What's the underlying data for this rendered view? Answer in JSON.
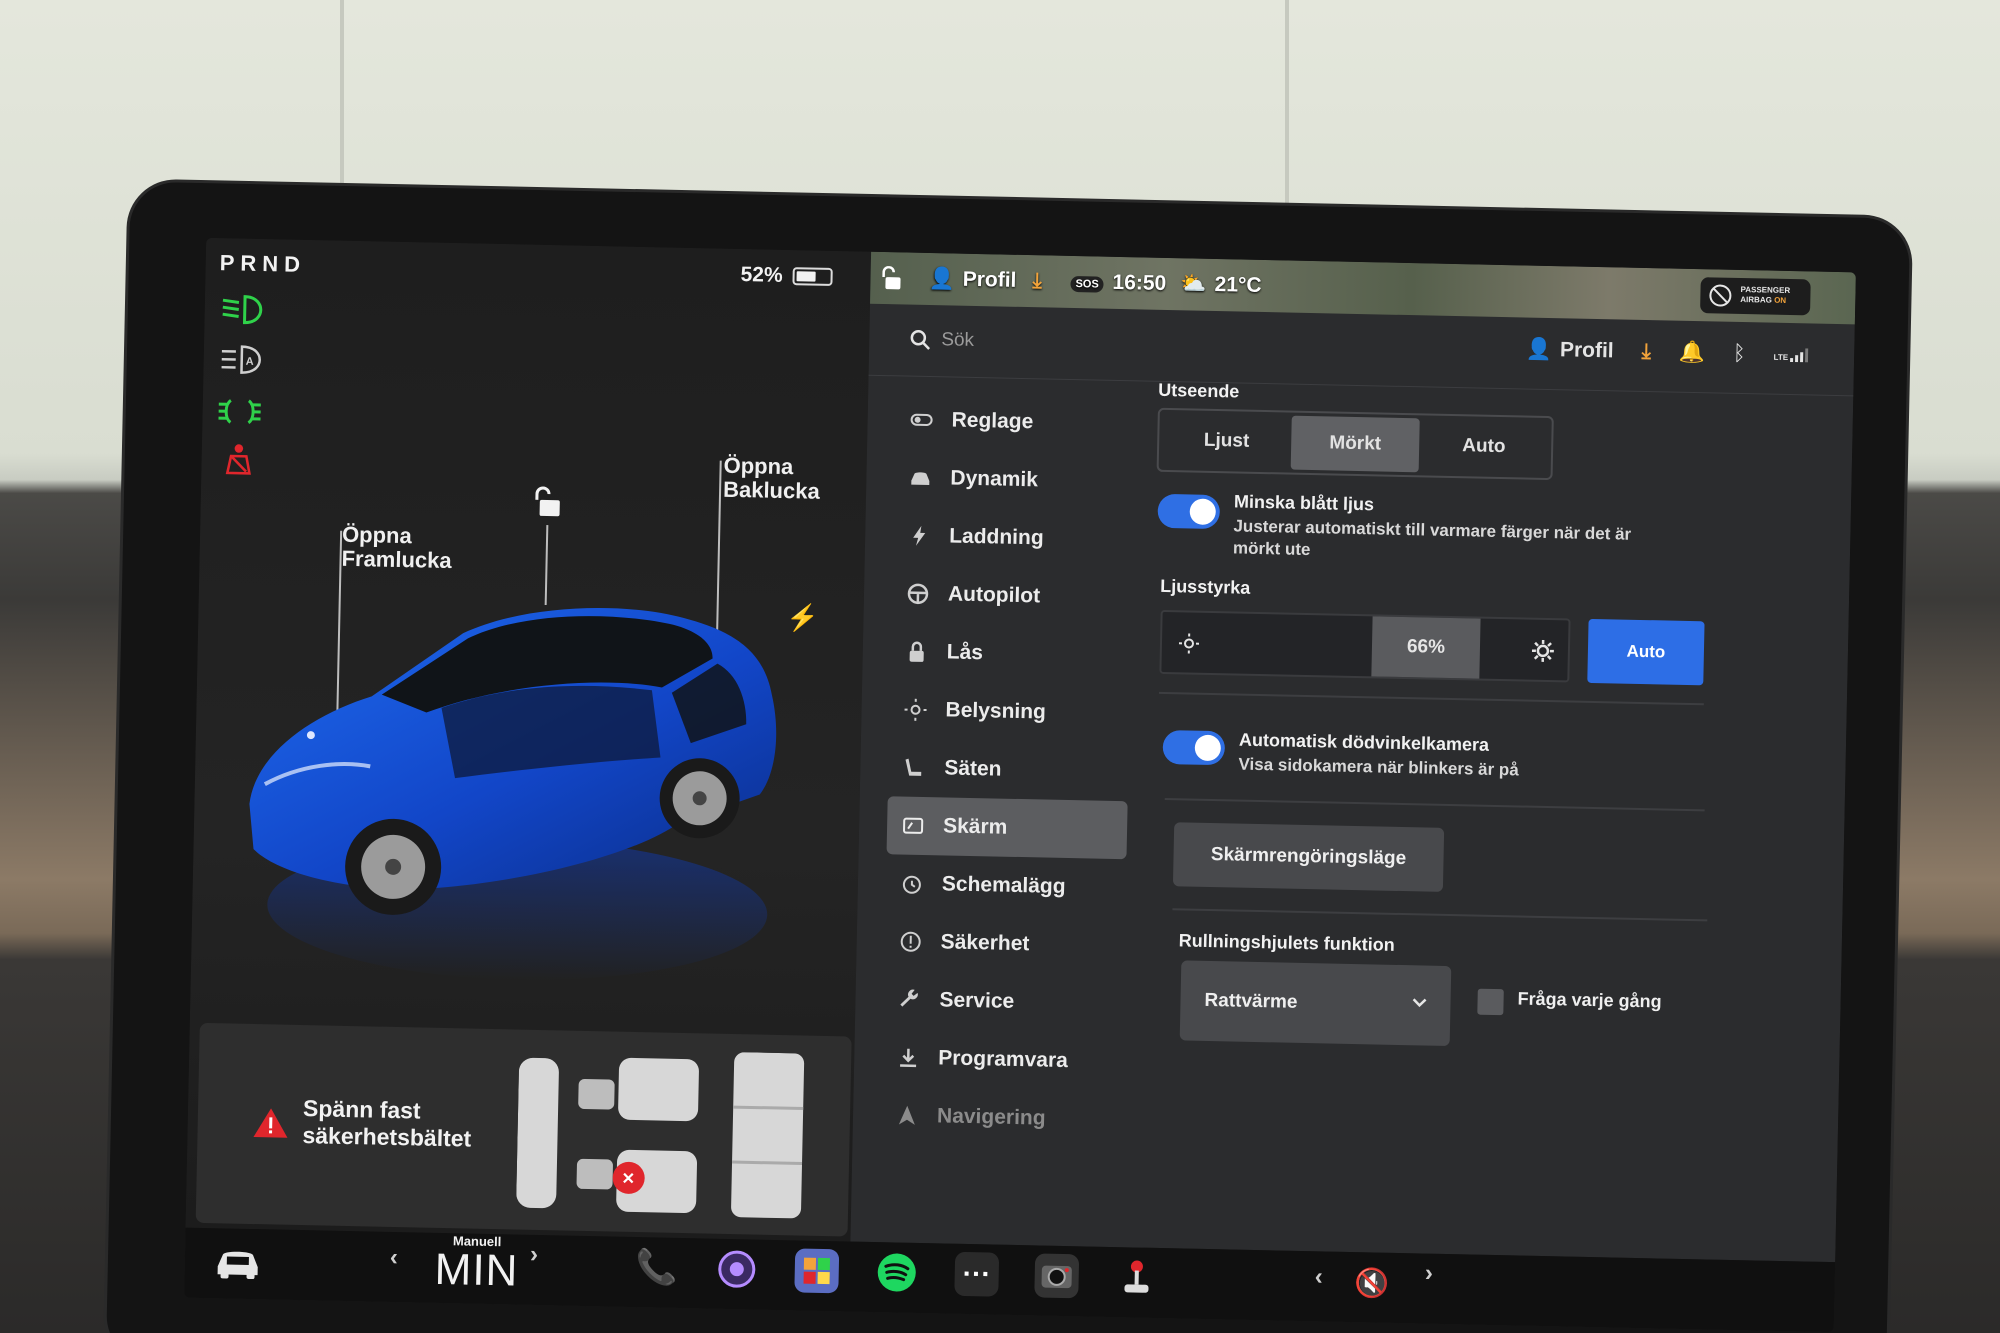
{
  "car_panel": {
    "gear_selector": "PRND",
    "battery_percent": "52%",
    "battery_level": 0.52,
    "callout_front_trunk": [
      "Öppna",
      "Framlucka"
    ],
    "callout_rear_trunk": [
      "Öppna",
      "Baklucka"
    ],
    "seatbelt_warning": [
      "Spänn fast",
      "säkerhetsbältet"
    ]
  },
  "status_bar": {
    "profile_label": "Profil",
    "time": "16:50",
    "temperature": "21°C",
    "sos_label": "SOS",
    "airbag_line1": "PASSENGER",
    "airbag_line2": "AIRBAG",
    "airbag_state": "ON"
  },
  "search": {
    "placeholder": "Sök"
  },
  "header_icons": {
    "profile_label": "Profil",
    "lte_label": "LTE"
  },
  "nav": {
    "items": [
      {
        "label": "Reglage",
        "icon": "toggle-icon"
      },
      {
        "label": "Dynamik",
        "icon": "car-icon"
      },
      {
        "label": "Laddning",
        "icon": "bolt-icon"
      },
      {
        "label": "Autopilot",
        "icon": "steering-wheel-icon"
      },
      {
        "label": "Lås",
        "icon": "lock-icon"
      },
      {
        "label": "Belysning",
        "icon": "sun-icon"
      },
      {
        "label": "Säten",
        "icon": "seat-icon"
      },
      {
        "label": "Skärm",
        "icon": "display-icon"
      },
      {
        "label": "Schemalägg",
        "icon": "alarm-clock-icon"
      },
      {
        "label": "Säkerhet",
        "icon": "info-circle-icon"
      },
      {
        "label": "Service",
        "icon": "wrench-icon"
      },
      {
        "label": "Programvara",
        "icon": "download-icon"
      },
      {
        "label": "Navigering",
        "icon": "navigation-icon"
      }
    ],
    "active_index": 7
  },
  "display_settings": {
    "appearance_label": "Utseende",
    "appearance_options": [
      "Ljust",
      "Mörkt",
      "Auto"
    ],
    "appearance_selected": "Mörkt",
    "reduce_blue_title": "Minska blått ljus",
    "reduce_blue_desc": "Justerar automatiskt till varmare färger när det är mörkt ute",
    "reduce_blue_on": true,
    "brightness_label": "Ljusstyrka",
    "brightness_value": "66%",
    "brightness_level": 0.66,
    "brightness_auto_label": "Auto",
    "blindspot_title": "Automatisk dödvinkelkamera",
    "blindspot_desc": "Visa sidokamera när blinkers är på",
    "blindspot_on": true,
    "clean_mode_label": "Skärmrengöringsläge",
    "scroll_wheel_label": "Rullningshjulets funktion",
    "scroll_wheel_value": "Rattvärme",
    "ask_every_time_label": "Fråga varje gång",
    "ask_every_time_checked": false
  },
  "dock": {
    "climate_mode_small": "Manuell",
    "climate_mode_big": "MIN"
  },
  "colors": {
    "accent_blue": "#2d6ee6",
    "telltale_green": "#2fd24a",
    "warning_red": "#e0262c",
    "download_orange": "#f2a33b"
  }
}
